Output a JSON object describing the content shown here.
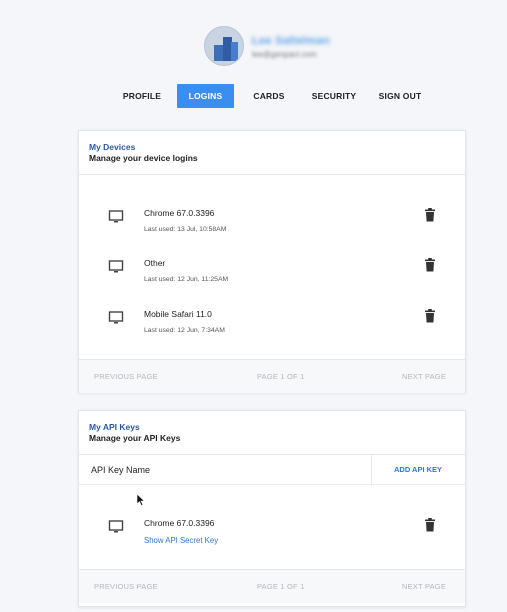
{
  "user": {
    "name": "Lee Saltelman",
    "email": "lee@genpact.com"
  },
  "tabs": [
    {
      "label": "PROFILE",
      "active": false
    },
    {
      "label": "LOGINS",
      "active": true
    },
    {
      "label": "CARDS",
      "active": false
    },
    {
      "label": "SECURITY",
      "active": false
    },
    {
      "label": "SIGN OUT",
      "active": false
    }
  ],
  "devices": {
    "title": "My Devices",
    "subtitle": "Manage your device logins",
    "items": [
      {
        "name": "Chrome 67.0.3396",
        "last_used": "Last used: 13 Jul, 10:58AM",
        "icon": "monitor-icon"
      },
      {
        "name": "Other",
        "last_used": "Last used: 12 Jun, 11:25AM",
        "icon": "monitor-icon"
      },
      {
        "name": "Mobile Safari 11.0",
        "last_used": "Last used: 12 Jun, 7:34AM",
        "icon": "monitor-icon"
      }
    ],
    "pager": {
      "prev": "PREVIOUS PAGE",
      "page": "PAGE 1 OF 1",
      "next": "NEXT PAGE"
    }
  },
  "api_keys": {
    "title": "My API Keys",
    "subtitle": "Manage your API Keys",
    "column_label": "API Key Name",
    "add_label": "ADD API KEY",
    "items": [
      {
        "name": "Chrome 67.0.3396",
        "link": "Show API Secret Key",
        "icon": "monitor-icon"
      }
    ],
    "pager": {
      "prev": "PREVIOUS PAGE",
      "page": "PAGE 1 OF 1",
      "next": "NEXT PAGE"
    }
  },
  "colors": {
    "accent": "#3a8ef0",
    "link": "#2c7ad6",
    "card_title": "#2a5a9a",
    "background": "#f4f6f9"
  }
}
